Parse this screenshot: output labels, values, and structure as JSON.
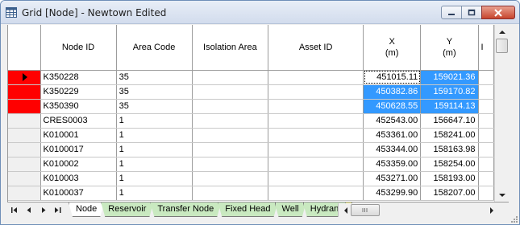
{
  "window": {
    "title": "Grid [Node] - Newtown Edited",
    "icon": "grid-icon",
    "controls": [
      "minimize-icon",
      "maximize-icon",
      "close-icon"
    ]
  },
  "grid": {
    "columns": [
      {
        "id": "selector",
        "label": ""
      },
      {
        "id": "node_id",
        "label": "Node ID"
      },
      {
        "id": "area_code",
        "label": "Area Code"
      },
      {
        "id": "isolation_area",
        "label": "Isolation Area"
      },
      {
        "id": "asset_id",
        "label": "Asset ID"
      },
      {
        "id": "x",
        "label": "X",
        "unit": "(m)"
      },
      {
        "id": "y",
        "label": "Y",
        "unit": "(m)"
      },
      {
        "id": "next",
        "label": "I"
      }
    ],
    "rows": [
      {
        "flag": "red",
        "current": true,
        "node_id": "K350228",
        "area_code": "35",
        "isolation_area": "",
        "asset_id": "",
        "x": "451015.11",
        "y": "159021.36"
      },
      {
        "flag": "red",
        "current": false,
        "node_id": "K350229",
        "area_code": "35",
        "isolation_area": "",
        "asset_id": "",
        "x": "450382.86",
        "y": "159170.82"
      },
      {
        "flag": "red",
        "current": false,
        "node_id": "K350390",
        "area_code": "35",
        "isolation_area": "",
        "asset_id": "",
        "x": "450628.55",
        "y": "159114.13"
      },
      {
        "flag": "",
        "current": false,
        "node_id": "CRES0003",
        "area_code": "1",
        "isolation_area": "",
        "asset_id": "",
        "x": "452543.00",
        "y": "156647.10"
      },
      {
        "flag": "",
        "current": false,
        "node_id": "K010001",
        "area_code": "1",
        "isolation_area": "",
        "asset_id": "",
        "x": "453361.00",
        "y": "158241.00"
      },
      {
        "flag": "",
        "current": false,
        "node_id": "K0100017",
        "area_code": "1",
        "isolation_area": "",
        "asset_id": "",
        "x": "453344.00",
        "y": "158163.98"
      },
      {
        "flag": "",
        "current": false,
        "node_id": "K010002",
        "area_code": "1",
        "isolation_area": "",
        "asset_id": "",
        "x": "453359.00",
        "y": "158254.00"
      },
      {
        "flag": "",
        "current": false,
        "node_id": "K010003",
        "area_code": "1",
        "isolation_area": "",
        "asset_id": "",
        "x": "453271.00",
        "y": "158193.00"
      },
      {
        "flag": "",
        "current": false,
        "node_id": "K0100037",
        "area_code": "1",
        "isolation_area": "",
        "asset_id": "",
        "x": "453299.90",
        "y": "158207.00"
      }
    ]
  },
  "tabs": [
    {
      "label": "Node",
      "active": true
    },
    {
      "label": "Reservoir",
      "active": false
    },
    {
      "label": "Transfer Node",
      "active": false
    },
    {
      "label": "Fixed Head",
      "active": false
    },
    {
      "label": "Well",
      "active": false
    },
    {
      "label": "Hydrant",
      "active": false
    }
  ],
  "colors": {
    "flag_red": "#ff0000",
    "selection_blue": "#3399ff",
    "tab_green": "#c9e9c0",
    "tab_partial_yellow": "#f4f08a"
  }
}
